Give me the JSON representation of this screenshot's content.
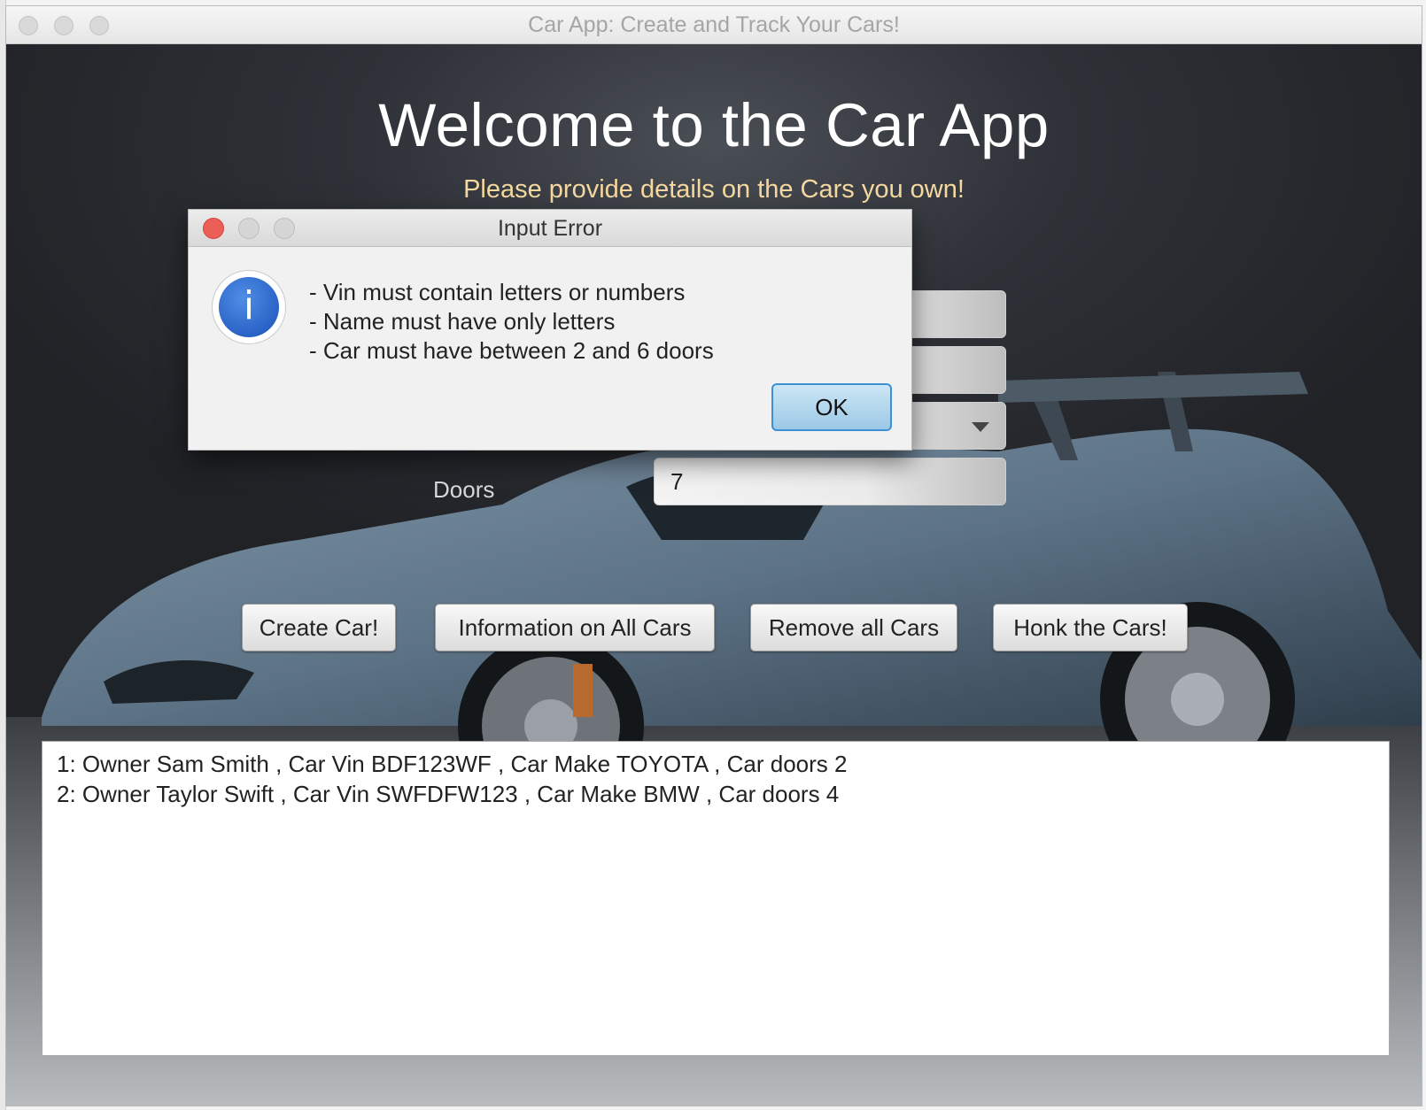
{
  "window": {
    "title": "Car App: Create and Track Your Cars!"
  },
  "header": {
    "welcome": "Welcome to the Car App",
    "subtitle": "Please provide details on the Cars you own!"
  },
  "form": {
    "doors_label": "Doors",
    "doors_value": "7"
  },
  "buttons": {
    "create": "Create Car!",
    "info": "Information on All Cars",
    "remove": "Remove all Cars",
    "honk": "Honk the Cars!"
  },
  "output": {
    "lines": [
      "1: Owner Sam Smith , Car Vin BDF123WF , Car Make TOYOTA , Car doors 2",
      "2: Owner Taylor Swift , Car Vin SWFDFW123 , Car Make BMW , Car doors 4"
    ]
  },
  "dialog": {
    "title": "Input Error",
    "icon": "info-icon",
    "icon_glyph": "i",
    "messages": [
      "- Vin must contain letters or numbers",
      "- Name must have only letters",
      "- Car must have between 2 and 6 doors"
    ],
    "ok_label": "OK"
  },
  "colors": {
    "subtitle": "#f6d9a0",
    "dialog_close": "#ec5f57",
    "ok_border": "#3d8fd6"
  }
}
